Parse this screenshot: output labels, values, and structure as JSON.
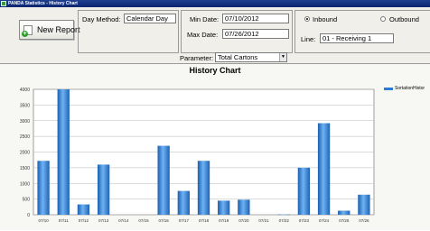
{
  "window": {
    "title": "PANDA Statistics - History Chart"
  },
  "toolbar": {
    "new_report_label": "New Report",
    "day_method_label": "Day Method:",
    "day_method_value": "Calendar Day",
    "min_date_label": "Min Date:",
    "min_date_value": "07/10/2012",
    "max_date_label": "Max Date:",
    "max_date_value": "07/26/2012",
    "inbound_label": "Inbound",
    "outbound_label": "Outbound",
    "selected_direction": "Inbound",
    "line_label": "Line:",
    "line_value": "01 - Receiving 1",
    "parameter_label": "Parameter:",
    "parameter_value": "Total Cartons"
  },
  "colors": {
    "bar": "#2f7fd8",
    "titlebar": "#0a2470"
  },
  "chart_data": {
    "type": "bar",
    "title": "History Chart",
    "categories": [
      "07/10",
      "07/11",
      "07/12",
      "07/13",
      "07/14",
      "07/15",
      "07/16",
      "07/17",
      "07/18",
      "07/19",
      "07/20",
      "07/21",
      "07/22",
      "07/23",
      "07/24",
      "07/25",
      "07/26"
    ],
    "series": [
      {
        "name": "SortationHistor",
        "values": [
          1720,
          4000,
          330,
          1600,
          0,
          0,
          2200,
          760,
          1720,
          450,
          480,
          0,
          10,
          1500,
          2920,
          130,
          640
        ]
      }
    ],
    "y_ticks": [
      "0",
      "500",
      "1000",
      "1500",
      "2000",
      "2500",
      "3000",
      "3500",
      "4000"
    ],
    "ylim": [
      0,
      4000
    ],
    "grid": true,
    "legend_position": "right"
  }
}
